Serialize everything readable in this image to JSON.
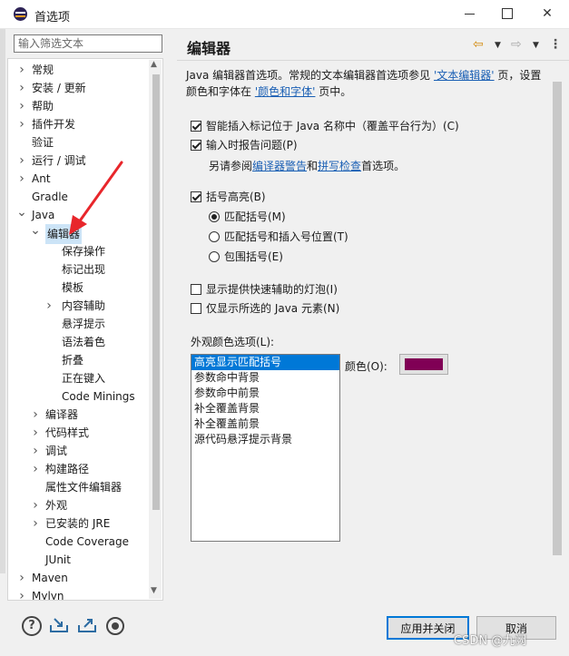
{
  "window": {
    "title": "首选项"
  },
  "filter": {
    "placeholder": "输入筛选文本"
  },
  "tree": {
    "items": [
      {
        "label": "常规",
        "level": 0,
        "arrow": "right"
      },
      {
        "label": "安装 / 更新",
        "level": 0,
        "arrow": "right"
      },
      {
        "label": "帮助",
        "level": 0,
        "arrow": "right"
      },
      {
        "label": "插件开发",
        "level": 0,
        "arrow": "right"
      },
      {
        "label": "验证",
        "level": 0,
        "arrow": "none"
      },
      {
        "label": "运行 / 调试",
        "level": 0,
        "arrow": "right"
      },
      {
        "label": "Ant",
        "level": 0,
        "arrow": "right"
      },
      {
        "label": "Gradle",
        "level": 0,
        "arrow": "none"
      },
      {
        "label": "Java",
        "level": 0,
        "arrow": "down"
      },
      {
        "label": "编辑器",
        "level": 1,
        "arrow": "down",
        "selected": true
      },
      {
        "label": "保存操作",
        "level": 2,
        "arrow": "none"
      },
      {
        "label": "标记出现",
        "level": 2,
        "arrow": "none"
      },
      {
        "label": "模板",
        "level": 2,
        "arrow": "none"
      },
      {
        "label": "内容辅助",
        "level": 2,
        "arrow": "right"
      },
      {
        "label": "悬浮提示",
        "level": 2,
        "arrow": "none"
      },
      {
        "label": "语法着色",
        "level": 2,
        "arrow": "none"
      },
      {
        "label": "折叠",
        "level": 2,
        "arrow": "none"
      },
      {
        "label": "正在键入",
        "level": 2,
        "arrow": "none"
      },
      {
        "label": "Code Minings",
        "level": 2,
        "arrow": "none"
      },
      {
        "label": "编译器",
        "level": 1,
        "arrow": "right"
      },
      {
        "label": "代码样式",
        "level": 1,
        "arrow": "right"
      },
      {
        "label": "调试",
        "level": 1,
        "arrow": "right"
      },
      {
        "label": "构建路径",
        "level": 1,
        "arrow": "right"
      },
      {
        "label": "属性文件编辑器",
        "level": 1,
        "arrow": "none"
      },
      {
        "label": "外观",
        "level": 1,
        "arrow": "right"
      },
      {
        "label": "已安装的 JRE",
        "level": 1,
        "arrow": "right"
      },
      {
        "label": "Code Coverage",
        "level": 1,
        "arrow": "none"
      },
      {
        "label": "JUnit",
        "level": 1,
        "arrow": "none"
      },
      {
        "label": "Maven",
        "level": 0,
        "arrow": "right"
      },
      {
        "label": "Mylyn",
        "level": 0,
        "arrow": "right"
      }
    ]
  },
  "page": {
    "title": "编辑器",
    "desc_part1": "Java 编辑器首选项。常规的文本编辑器首选项参见 ",
    "desc_link1": "'文本编辑器'",
    "desc_part2": " 页，设置颜色和字体在 ",
    "desc_link2": "'颜色和字体'",
    "desc_part3": " 页中。",
    "options": {
      "smart_insert": {
        "label": "智能插入标记位于 Java 名称中（覆盖平台行为）(C)",
        "checked": true
      },
      "report_problems": {
        "label": "输入时报告问题(P)",
        "checked": true
      },
      "see_also_prefix": "另请参阅",
      "see_also_link1": "编译器警告",
      "see_also_and": "和",
      "see_also_link2": "拼写检查",
      "see_also_suffix": "首选项。",
      "bracket_highlight": {
        "label": "括号高亮(B)",
        "checked": true
      },
      "radio_match": {
        "label": "匹配括号(M)",
        "checked": true
      },
      "radio_match_insert": {
        "label": "匹配括号和插入号位置(T)",
        "checked": false
      },
      "radio_enclosing": {
        "label": "包围括号(E)",
        "checked": false
      },
      "quick_assist": {
        "label": "显示提供快速辅助的灯泡(I)",
        "checked": false
      },
      "show_selected": {
        "label": "仅显示所选的 Java 元素(N)",
        "checked": false
      }
    },
    "appearance": {
      "label": "外观颜色选项(L):",
      "items": [
        "高亮显示匹配括号",
        "参数命中背景",
        "参数命中前景",
        "补全覆盖背景",
        "补全覆盖前景",
        "源代码悬浮提示背景"
      ],
      "selected_index": 0,
      "color_label": "颜色(O):",
      "color_value": "#800055"
    }
  },
  "buttons": {
    "apply_close": "应用并关闭",
    "cancel": "取消"
  },
  "icons": {
    "help": "?",
    "import": "import-icon",
    "export": "export-icon",
    "record": "record-icon"
  },
  "watermark": "CSDN @九阙"
}
